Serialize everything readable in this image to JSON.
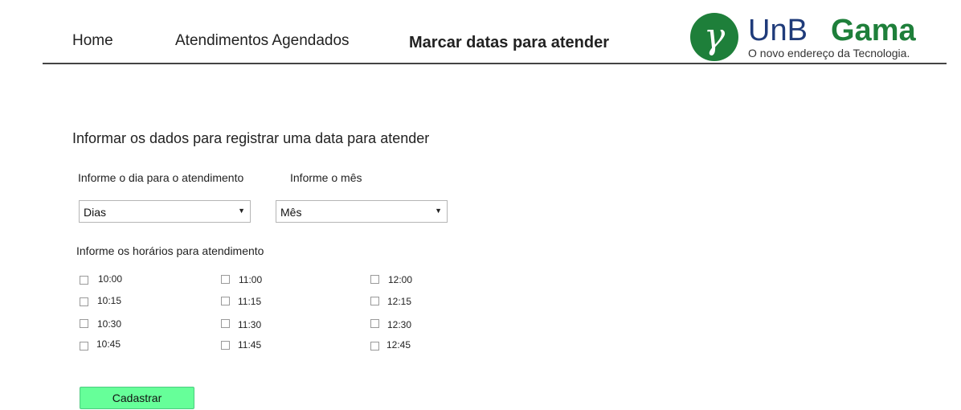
{
  "nav": {
    "home": "Home",
    "appointments": "Atendimentos Agendados",
    "schedule": "Marcar datas para atender"
  },
  "logo": {
    "symbol": "γ",
    "unb": "UnB",
    "gama": "Gama",
    "tagline": "O novo endereço da Tecnologia.",
    "colors": {
      "green": "#1e7f3a",
      "blue": "#1f3b7a"
    }
  },
  "form": {
    "title": "Informar os dados para registrar uma data para atender",
    "day_label": "Informe o dia para o atendimento",
    "month_label": "Informe o mês",
    "day_select": {
      "selected": "Dias"
    },
    "month_select": {
      "selected": "Mês"
    },
    "hours_label": "Informe os horários para atendimento",
    "hours": [
      [
        "10:00",
        "10:15",
        "10:30",
        "10:45"
      ],
      [
        "11:00",
        "11:15",
        "11:30",
        "11:45"
      ],
      [
        "12:00",
        "12:15",
        "12:30",
        "12:45"
      ]
    ],
    "submit_label": "Cadastrar",
    "submit_color": "#66ff99"
  }
}
